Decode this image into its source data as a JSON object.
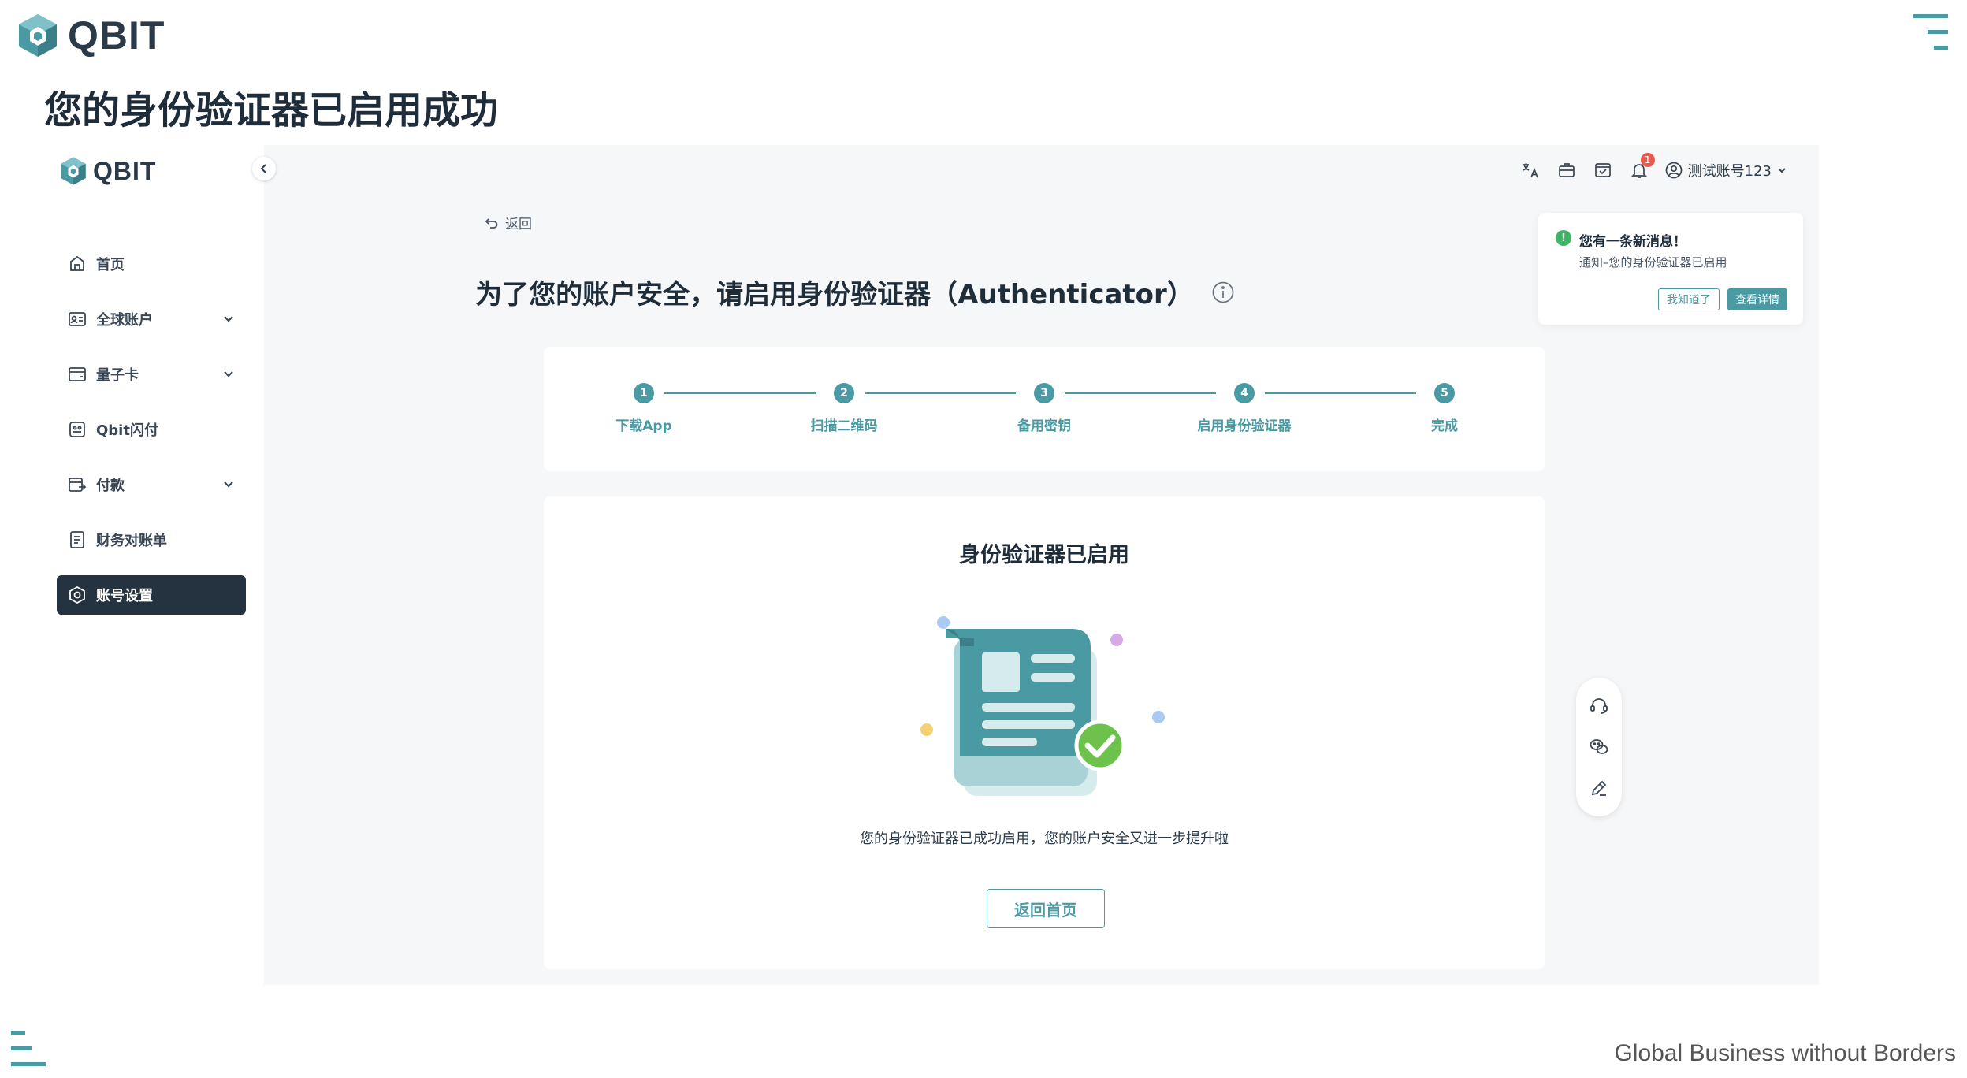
{
  "slide": {
    "logo_text": "QBIT",
    "title": "您的身份验证器已启用成功",
    "tagline": "Global Business without Borders"
  },
  "sidebar": {
    "logo_text": "QBIT",
    "items": [
      {
        "label": "首页",
        "icon": "home-icon",
        "has_caret": false,
        "active": false
      },
      {
        "label": "全球账户",
        "icon": "id-card-icon",
        "has_caret": true,
        "active": false
      },
      {
        "label": "量子卡",
        "icon": "card-icon",
        "has_caret": true,
        "active": false
      },
      {
        "label": "Qbit闪付",
        "icon": "flash-pay-icon",
        "has_caret": false,
        "active": false
      },
      {
        "label": "付款",
        "icon": "payment-icon",
        "has_caret": true,
        "active": false
      },
      {
        "label": "财务对账单",
        "icon": "statement-icon",
        "has_caret": false,
        "active": false
      },
      {
        "label": "账号设置",
        "icon": "settings-icon",
        "has_caret": false,
        "active": true
      }
    ]
  },
  "topbar": {
    "notification_count": "1",
    "user_name": "测试账号123"
  },
  "main": {
    "back_label": "返回",
    "heading": "为了您的账户安全，请启用身份验证器（Authenticator）",
    "steps": [
      {
        "num": "1",
        "label": "下载App"
      },
      {
        "num": "2",
        "label": "扫描二维码"
      },
      {
        "num": "3",
        "label": "备用密钥"
      },
      {
        "num": "4",
        "label": "启用身份验证器"
      },
      {
        "num": "5",
        "label": "完成"
      }
    ],
    "result_title": "身份验证器已启用",
    "result_desc": "您的身份验证器已成功启用，您的账户安全又进一步提升啦",
    "home_button": "返回首页"
  },
  "notification": {
    "title": "您有一条新消息！",
    "body": "通知–您的身份验证器已启用",
    "dismiss": "我知道了",
    "details": "查看详情"
  },
  "colors": {
    "accent": "#4a9aa4",
    "dark": "#24333f",
    "success": "#6cc24a",
    "badge": "#e85a50"
  }
}
